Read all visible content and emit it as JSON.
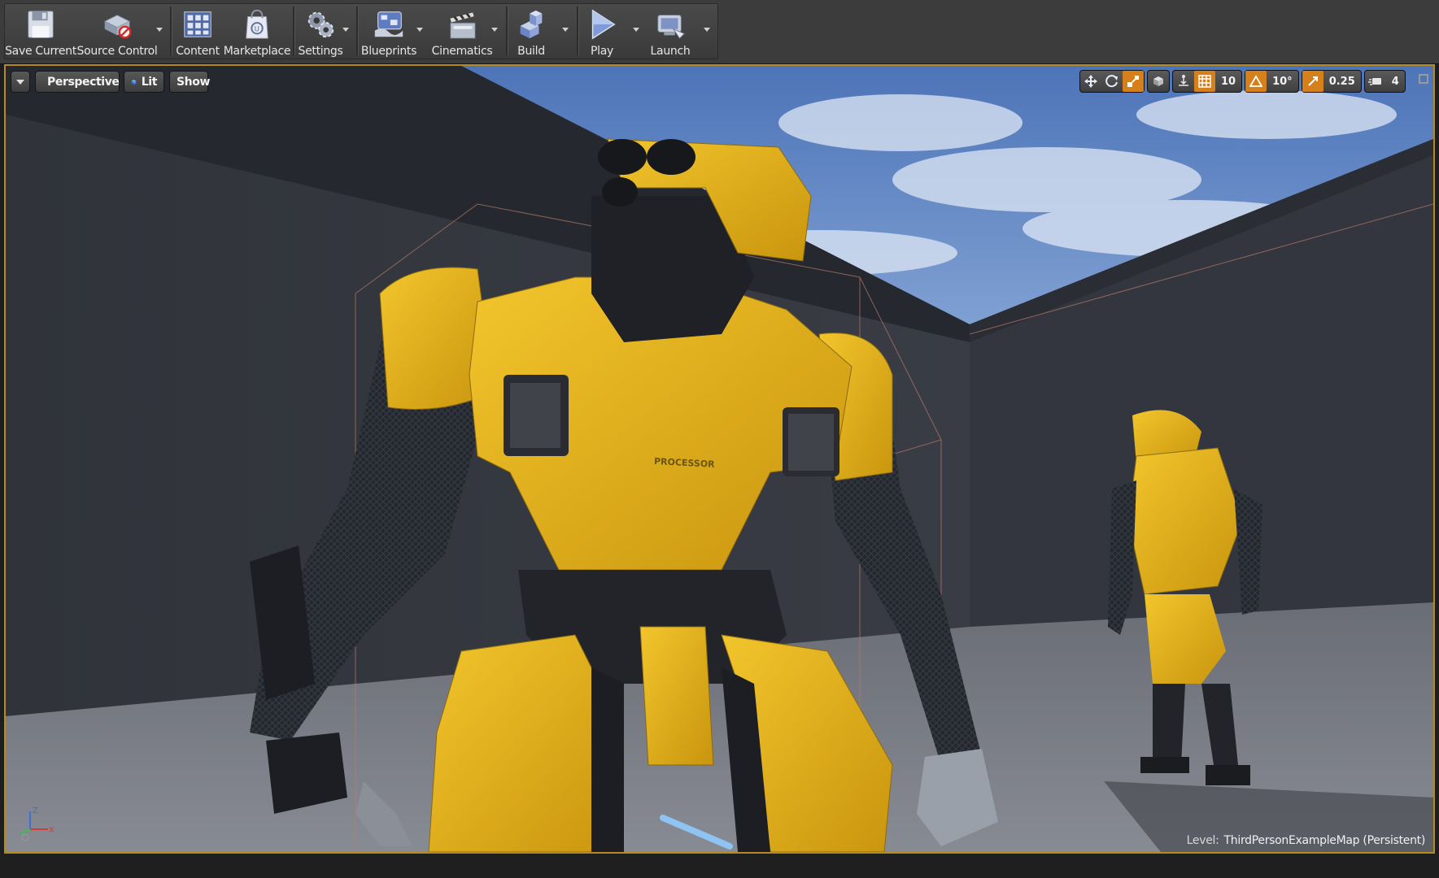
{
  "toolbar": {
    "buttons": [
      {
        "label": "Save Current",
        "icon": "save-icon"
      },
      {
        "label": "Source Control",
        "icon": "source-control-icon"
      },
      {
        "label": "Content",
        "icon": "content-browser-icon"
      },
      {
        "label": "Marketplace",
        "icon": "marketplace-icon"
      },
      {
        "label": "Settings",
        "icon": "settings-icon"
      },
      {
        "label": "Blueprints",
        "icon": "blueprints-icon"
      },
      {
        "label": "Cinematics",
        "icon": "cinematics-icon"
      },
      {
        "label": "Build",
        "icon": "build-icon"
      },
      {
        "label": "Play",
        "icon": "play-icon"
      },
      {
        "label": "Launch",
        "icon": "launch-icon"
      }
    ]
  },
  "viewport": {
    "view_mode": "Perspective",
    "lighting_mode": "Lit",
    "show_label": "Show",
    "grid_snap": "10",
    "rotation_snap": "10°",
    "scale_snap": "0.25",
    "camera_speed": "4",
    "level_label": "Level:",
    "level_name": "ThirdPersonExampleMap (Persistent)",
    "chest_text": "PROCESSOR",
    "axis_labels": {
      "z": "Z",
      "x": "X"
    }
  },
  "colors": {
    "selection_border": "#b58a1e",
    "active_tool": "#d5801a",
    "robot_yellow": "#e8b41c"
  }
}
